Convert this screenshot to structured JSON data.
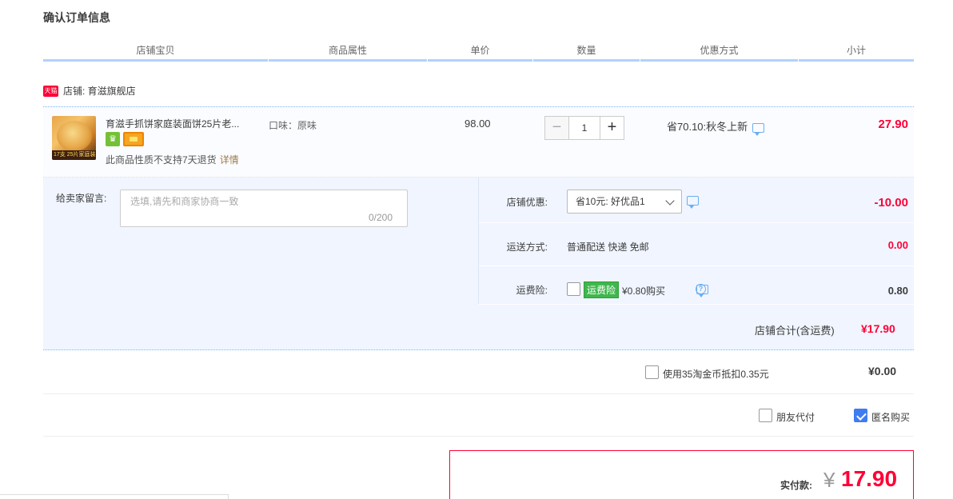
{
  "page": {
    "title": "确认订单信息"
  },
  "columns": [
    "店铺宝贝",
    "商品属性",
    "单价",
    "数量",
    "优惠方式",
    "小计"
  ],
  "shop": {
    "badge": "天猫",
    "name": "店铺: 育滋旗舰店"
  },
  "item": {
    "title": "育滋手抓饼家庭装面饼25片老...",
    "image_tag": "17支 25片家庭装",
    "attr": "口味：原味",
    "price": "98.00",
    "qty": "1",
    "qty_minus": "−",
    "qty_plus": "+",
    "promo": "省70.10:秋冬上新",
    "subtotal": "27.90",
    "return_note": "此商品性质不支持7天退货",
    "return_link": "详情"
  },
  "message": {
    "label": "给卖家留言:",
    "placeholder": "选填,请先和商家协商一致",
    "counter": "0/200"
  },
  "shop_discount": {
    "label": "店铺优惠:",
    "selected": "省10元: 好优品1",
    "amount": "-10.00"
  },
  "shipping": {
    "label": "运送方式:",
    "value": "普通配送 快递 免邮",
    "amount": "0.00"
  },
  "insurance": {
    "label": "运费险:",
    "tag": "运费险",
    "text": "¥0.80购买",
    "help": "?",
    "amount": "0.80",
    "checked": false
  },
  "shop_total": {
    "label": "店铺合计(含运费)",
    "value": "¥17.90"
  },
  "coins": {
    "text": "使用35淘金币抵扣0.35元",
    "value": "¥0.00",
    "checked": false
  },
  "options": {
    "friend_pay": "朋友代付",
    "anonymous": "匿名购买",
    "friend_checked": false,
    "anonymous_checked": true
  },
  "payment": {
    "label": "实付款:",
    "currency": "¥",
    "amount": "17.90"
  },
  "colors": {
    "accent_red": "#ff0036",
    "header_border": "#b2d1ff",
    "panel_bg": "#f0f5ff",
    "check_blue": "#3f7cf2"
  }
}
